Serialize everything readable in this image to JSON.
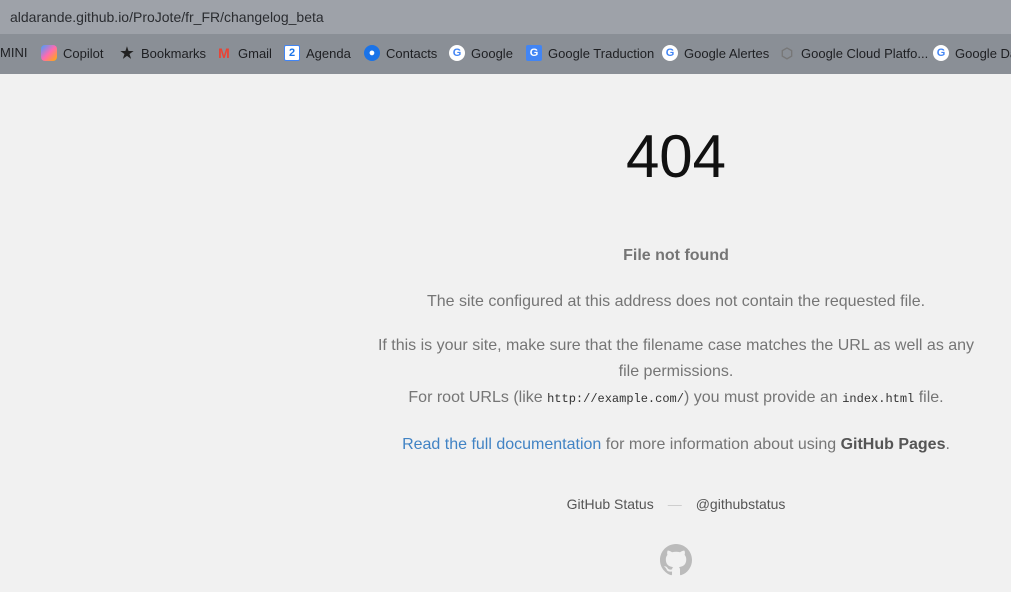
{
  "browser": {
    "url": "aldarande.github.io/ProJote/fr_FR/changelog_beta",
    "bookmarks": [
      {
        "label": "MINI",
        "icon": "none"
      },
      {
        "label": "Copilot",
        "icon": "copilot-icon"
      },
      {
        "label": "Bookmarks",
        "icon": "star-icon"
      },
      {
        "label": "Gmail",
        "icon": "gmail-icon"
      },
      {
        "label": "Agenda",
        "icon": "calendar-icon"
      },
      {
        "label": "Contacts",
        "icon": "contacts-icon"
      },
      {
        "label": "Google",
        "icon": "google-icon"
      },
      {
        "label": "Google Traduction",
        "icon": "translate-icon"
      },
      {
        "label": "Google Alertes",
        "icon": "google-icon"
      },
      {
        "label": "Google Cloud Platfo...",
        "icon": "cloud-icon"
      },
      {
        "label": "Google Da",
        "icon": "google-icon"
      }
    ]
  },
  "page": {
    "code": "404",
    "title": "File not found",
    "p1": "The site configured at this address does not contain the requested file.",
    "p2": "If this is your site, make sure that the filename case matches the URL as well as any file permissions.",
    "p3a": "For root URLs (like ",
    "p3code": "http://example.com/",
    "p3b": ") you must provide an ",
    "p3code2": "index.html",
    "p3c": " file.",
    "link": "Read the full documentation",
    "p4a": " for more information about using ",
    "p4b": "GitHub Pages",
    "p4c": ".",
    "footer": {
      "status": "GitHub Status",
      "sep": "—",
      "twitter": "@githubstatus"
    }
  }
}
